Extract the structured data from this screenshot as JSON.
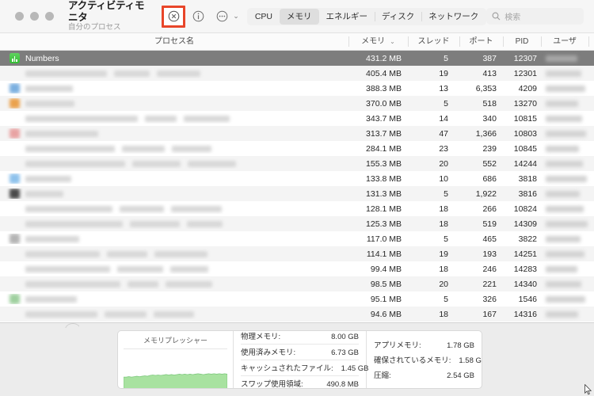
{
  "window": {
    "title": "アクティビティモニタ",
    "subtitle": "自分のプロセス"
  },
  "toolbar": {
    "stop_label": "⊗",
    "info_label": "ⓘ",
    "options_label": "⋯",
    "chevron": "⌄",
    "tabs": [
      {
        "label": "CPU",
        "active": false
      },
      {
        "label": "メモリ",
        "active": true
      },
      {
        "label": "エネルギー",
        "active": false
      },
      {
        "label": "ディスク",
        "active": false
      },
      {
        "label": "ネットワーク",
        "active": false
      }
    ],
    "highlight_color": "#e8462a"
  },
  "search": {
    "placeholder": "検索",
    "value": "",
    "icon": "search-icon"
  },
  "table": {
    "columns": {
      "name": "プロセス名",
      "memory": "メモリ",
      "sort_indicator": "⌄",
      "threads": "スレッド",
      "ports": "ポート",
      "pid": "PID",
      "user": "ユーザ"
    },
    "rows": [
      {
        "name": "Numbers",
        "redacted": false,
        "icon": "numbers-icon",
        "icon_color": "#35bb35",
        "memory": "431.2 MB",
        "threads": "5",
        "ports": "387",
        "pid": "12307",
        "selected": true
      },
      {
        "name": "",
        "redacted": true,
        "name_width": 0,
        "icon": "",
        "icon_color": "",
        "memory": "405.4 MB",
        "threads": "19",
        "ports": "413",
        "pid": "12301",
        "selected": false
      },
      {
        "name": "",
        "redacted": true,
        "name_width": 60,
        "icon": "app-icon",
        "icon_color": "#7cb0e0",
        "memory": "388.3 MB",
        "threads": "13",
        "ports": "6,353",
        "pid": "4209",
        "selected": false
      },
      {
        "name": "",
        "redacted": true,
        "name_width": 62,
        "icon": "app-icon",
        "icon_color": "#eaa24e",
        "memory": "370.0 MB",
        "threads": "5",
        "ports": "518",
        "pid": "13270",
        "selected": false
      },
      {
        "name": "",
        "redacted": true,
        "name_width": 0,
        "icon": "",
        "icon_color": "",
        "memory": "343.7 MB",
        "threads": "14",
        "ports": "340",
        "pid": "10815",
        "selected": false
      },
      {
        "name": "",
        "redacted": true,
        "name_width": 92,
        "icon": "app-icon",
        "icon_color": "#e8a3a3",
        "memory": "313.7 MB",
        "threads": "47",
        "ports": "1,366",
        "pid": "10803",
        "selected": false
      },
      {
        "name": "",
        "redacted": true,
        "name_width": 0,
        "icon": "",
        "icon_color": "",
        "memory": "284.1 MB",
        "threads": "23",
        "ports": "239",
        "pid": "10845",
        "selected": false
      },
      {
        "name": "",
        "redacted": true,
        "name_width": 0,
        "icon": "",
        "icon_color": "",
        "memory": "155.3 MB",
        "threads": "20",
        "ports": "552",
        "pid": "14244",
        "selected": false
      },
      {
        "name": "",
        "redacted": true,
        "name_width": 58,
        "icon": "app-icon",
        "icon_color": "#8ec2ec",
        "memory": "133.8 MB",
        "threads": "10",
        "ports": "686",
        "pid": "3818",
        "selected": false
      },
      {
        "name": "",
        "redacted": true,
        "name_width": 48,
        "icon": "app-icon",
        "icon_color": "#4a4a4a",
        "memory": "131.3 MB",
        "threads": "5",
        "ports": "1,922",
        "pid": "3816",
        "selected": false
      },
      {
        "name": "",
        "redacted": true,
        "name_width": 0,
        "icon": "",
        "icon_color": "",
        "memory": "128.1 MB",
        "threads": "18",
        "ports": "266",
        "pid": "10824",
        "selected": false
      },
      {
        "name": "",
        "redacted": true,
        "name_width": 0,
        "icon": "",
        "icon_color": "",
        "memory": "125.3 MB",
        "threads": "18",
        "ports": "519",
        "pid": "14309",
        "selected": false
      },
      {
        "name": "",
        "redacted": true,
        "name_width": 68,
        "icon": "app-icon",
        "icon_color": "#b4b4b4",
        "memory": "117.0 MB",
        "threads": "5",
        "ports": "465",
        "pid": "3822",
        "selected": false
      },
      {
        "name": "",
        "redacted": true,
        "name_width": 0,
        "icon": "",
        "icon_color": "",
        "memory": "114.1 MB",
        "threads": "19",
        "ports": "193",
        "pid": "14251",
        "selected": false
      },
      {
        "name": "",
        "redacted": true,
        "name_width": 0,
        "icon": "",
        "icon_color": "",
        "memory": "99.4 MB",
        "threads": "18",
        "ports": "246",
        "pid": "14283",
        "selected": false
      },
      {
        "name": "",
        "redacted": true,
        "name_width": 0,
        "icon": "",
        "icon_color": "",
        "memory": "98.5 MB",
        "threads": "20",
        "ports": "221",
        "pid": "14340",
        "selected": false
      },
      {
        "name": "",
        "redacted": true,
        "name_width": 65,
        "icon": "app-icon",
        "icon_color": "#9fd09f",
        "memory": "95.1 MB",
        "threads": "5",
        "ports": "326",
        "pid": "1546",
        "selected": false
      },
      {
        "name": "",
        "redacted": true,
        "name_width": 0,
        "icon": "",
        "icon_color": "",
        "memory": "94.6 MB",
        "threads": "18",
        "ports": "167",
        "pid": "14316",
        "selected": false
      }
    ]
  },
  "bottom": {
    "pressure_title": "メモリプレッシャー",
    "pressure_color": "#a8e2a0",
    "stats_left": [
      {
        "label": "物理メモリ:",
        "value": "8.00 GB"
      },
      {
        "label": "使用済みメモリ:",
        "value": "6.73 GB"
      },
      {
        "label": "キャッシュされたファイル:",
        "value": "1.45 GB"
      },
      {
        "label": "スワップ使用領域:",
        "value": "490.8 MB"
      }
    ],
    "stats_right": [
      {
        "label": "アプリメモリ:",
        "value": "1.78 GB"
      },
      {
        "label": "確保されているメモリ:",
        "value": "1.58 GB"
      },
      {
        "label": "圧縮:",
        "value": "2.54 GB"
      }
    ]
  },
  "chart_data": {
    "type": "area",
    "title": "メモリプレッシャー",
    "series": [
      {
        "name": "memory pressure",
        "values": [
          33,
          33,
          34,
          33,
          34,
          35,
          34,
          35,
          36,
          35,
          37,
          38,
          37,
          38,
          37,
          38,
          39,
          38,
          39,
          38,
          39,
          40,
          39,
          40,
          39,
          40,
          39,
          40,
          41,
          40,
          39,
          40,
          41,
          40,
          41,
          40,
          41,
          40,
          41,
          40
        ]
      }
    ],
    "ylim": [
      0,
      100
    ],
    "grid": false,
    "legend": "none",
    "fill_color": "#a8e2a0"
  }
}
